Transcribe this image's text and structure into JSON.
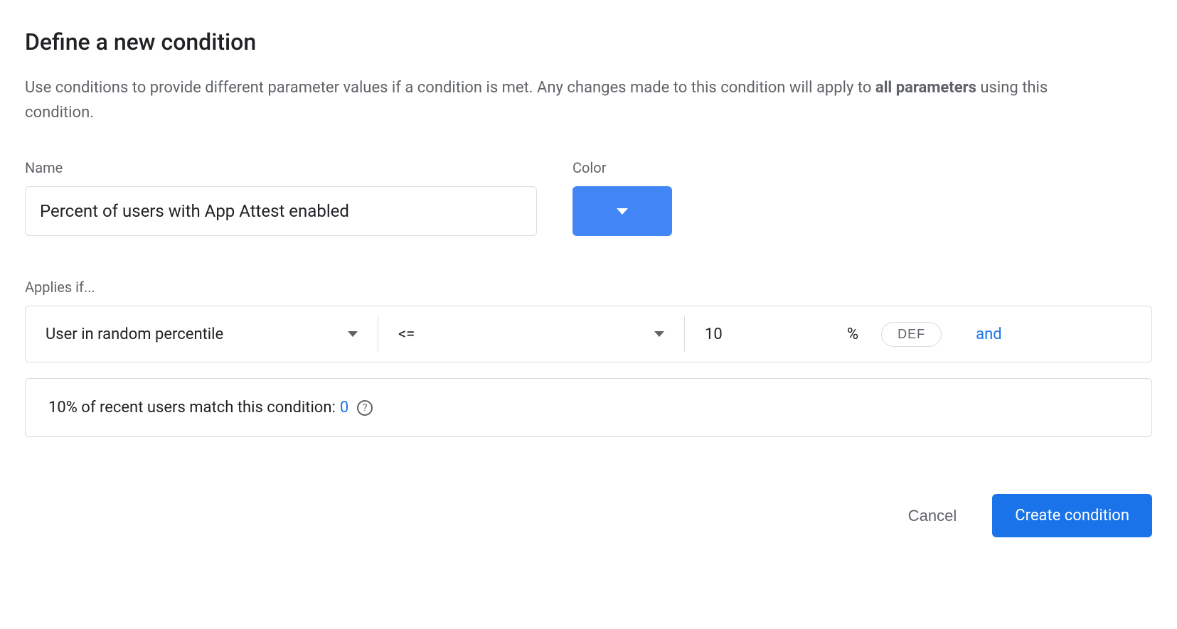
{
  "header": {
    "title": "Define a new condition",
    "description_prefix": "Use conditions to provide different parameter values if a condition is met. Any changes made to this condition will apply to ",
    "description_bold": "all parameters",
    "description_suffix": " using this condition."
  },
  "fields": {
    "name_label": "Name",
    "name_value": "Percent of users with App Attest enabled",
    "color_label": "Color",
    "color_value": "#4285f4"
  },
  "condition": {
    "applies_label": "Applies if...",
    "type": "User in random percentile",
    "operator": "<=",
    "value": "10",
    "unit": "%",
    "chip_label": "DEF",
    "and_label": "and"
  },
  "match": {
    "text": "10% of recent users match this condition:",
    "count": "0"
  },
  "actions": {
    "cancel": "Cancel",
    "create": "Create condition"
  }
}
